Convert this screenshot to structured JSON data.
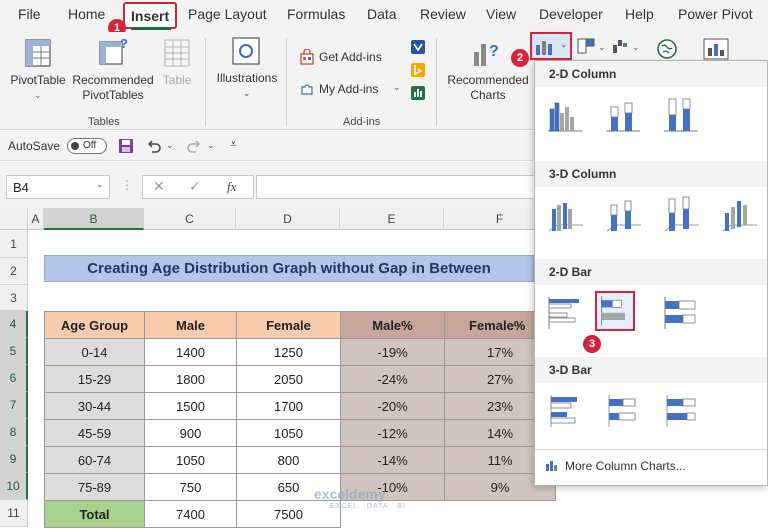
{
  "tabs": [
    "File",
    "Home",
    "Insert",
    "Page Layout",
    "Formulas",
    "Data",
    "Review",
    "View",
    "Developer",
    "Help",
    "Power Pivot"
  ],
  "ribbon": {
    "pivottable": "PivotTable",
    "recommended_pivot_1": "Recommended",
    "recommended_pivot_2": "PivotTables",
    "table": "Table",
    "illustrations": "Illustrations",
    "get_addins": "Get Add-ins",
    "my_addins": "My Add-ins",
    "recommended_charts_1": "Recommended",
    "recommended_charts_2": "Charts",
    "group_tables": "Tables",
    "group_addins": "Add-ins"
  },
  "qat": {
    "autosave": "AutoSave",
    "toggle": "Off"
  },
  "formula_bar": {
    "name_box": "B4",
    "fx": "fx",
    "value": ""
  },
  "columns": [
    "A",
    "B",
    "C",
    "D",
    "E",
    "F"
  ],
  "rows": [
    "1",
    "2",
    "3",
    "4",
    "5",
    "6",
    "7",
    "8",
    "9",
    "10",
    "11"
  ],
  "sheet": {
    "title": "Creating Age Distribution Graph without Gap in Between",
    "headers": [
      "Age Group",
      "Male",
      "Female",
      "Male%",
      "Female%"
    ],
    "data": [
      [
        "0-14",
        "1400",
        "1250",
        "-19%",
        "17%"
      ],
      [
        "15-29",
        "1800",
        "2050",
        "-24%",
        "27%"
      ],
      [
        "30-44",
        "1500",
        "1700",
        "-20%",
        "23%"
      ],
      [
        "45-59",
        "900",
        "1050",
        "-12%",
        "14%"
      ],
      [
        "60-74",
        "1050",
        "800",
        "-14%",
        "11%"
      ],
      [
        "75-89",
        "750",
        "650",
        "-10%",
        "9%"
      ]
    ],
    "total": [
      "Total",
      "7400",
      "7500"
    ]
  },
  "dropdown": {
    "sections": [
      "2-D Column",
      "3-D Column",
      "2-D Bar",
      "3-D Bar"
    ],
    "more": "More Column Charts..."
  },
  "badges": [
    "1",
    "2",
    "3"
  ],
  "watermark": {
    "name": "exceldemy",
    "tagline": "EXCEL · DATA · BI"
  },
  "colors": {
    "accent_red": "#d6223a",
    "excel_green": "#217346",
    "bar_blue": "#4472c4"
  }
}
